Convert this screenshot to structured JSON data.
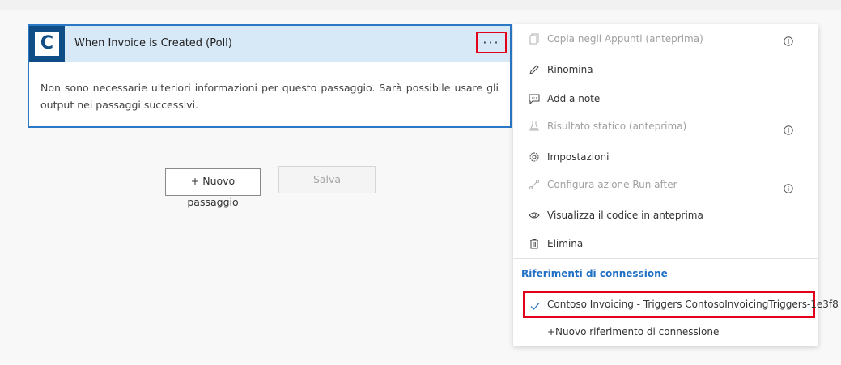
{
  "card": {
    "title": "When Invoice is Created (Poll)",
    "logo_letter": "C",
    "more_label": "···",
    "body": "Non sono necessarie ulteriori informazioni per questo passaggio. Sarà possibile usare gli output nei passaggi successivi."
  },
  "actions": {
    "new_step_line1": "+ Nuovo",
    "new_step_line2": "passaggio",
    "save": "Salva"
  },
  "menu": {
    "items": [
      {
        "label": "Copia negli Appunti (anteprima)",
        "icon": "copy-icon",
        "disabled": true,
        "info": true
      },
      {
        "label": "Rinomina",
        "icon": "pencil-icon",
        "disabled": false,
        "info": false
      },
      {
        "label": "Add a note",
        "icon": "comment-icon",
        "disabled": false,
        "info": false
      },
      {
        "label": "Risultato statico (anteprima)",
        "icon": "flask-icon",
        "disabled": true,
        "info": true
      },
      {
        "label": "Impostazioni",
        "icon": "gear-icon",
        "disabled": false,
        "info": false
      },
      {
        "label": "Configura azione Run after",
        "icon": "run-after-icon",
        "disabled": true,
        "info": true
      },
      {
        "label": "Visualizza il codice in anteprima",
        "icon": "eye-icon",
        "disabled": false,
        "info": false
      },
      {
        "label": "Elimina",
        "icon": "trash-icon",
        "disabled": false,
        "info": false
      }
    ],
    "section_title": "Riferimenti di connessione",
    "connection": "Contoso Invoicing - Triggers ContosoInvoicingTriggers-1e3f8",
    "new_connection": "+Nuovo riferimento di connessione"
  },
  "colors": {
    "accent": "#2a78c6",
    "header_bg": "#d7e8f7",
    "logo_bg": "#0f4d86",
    "highlight": "#e3001b",
    "link": "#1f6fc5"
  }
}
